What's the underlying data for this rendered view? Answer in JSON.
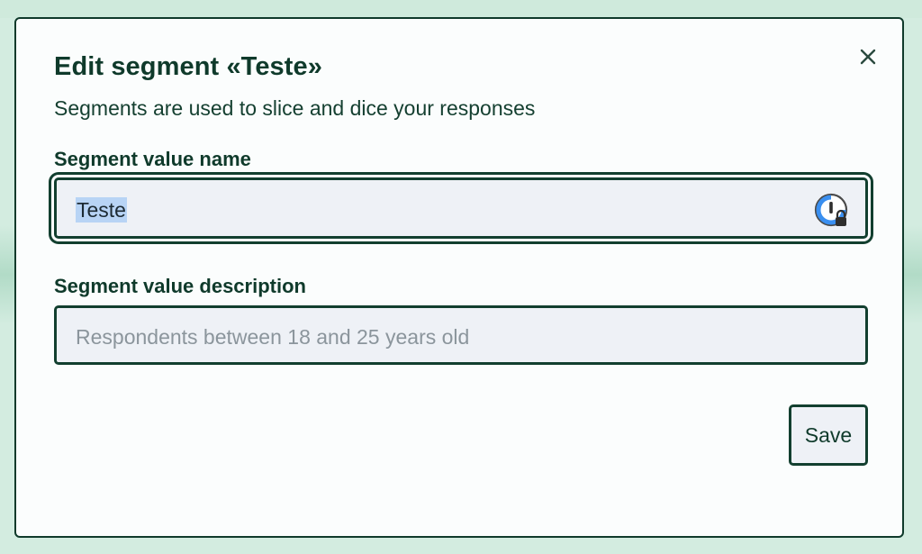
{
  "dialog": {
    "title": "Edit segment «Teste»",
    "subtitle": "Segments are used to slice and dice your responses",
    "close_icon": "close-icon"
  },
  "form": {
    "name_field": {
      "label": "Segment value name",
      "value": "Teste",
      "value_selected": true,
      "autofill_icon": "password-manager-lock-icon"
    },
    "description_field": {
      "label": "Segment value description",
      "value": "",
      "placeholder": "Respondents between 18 and 25 years old"
    },
    "save_label": "Save"
  },
  "colors": {
    "brand_dark": "#0f3a2b",
    "backdrop": "#d3ece0",
    "field_bg": "#eef1f6",
    "selection": "#b8d4f5",
    "autofill_accent": "#3a8ff0"
  }
}
